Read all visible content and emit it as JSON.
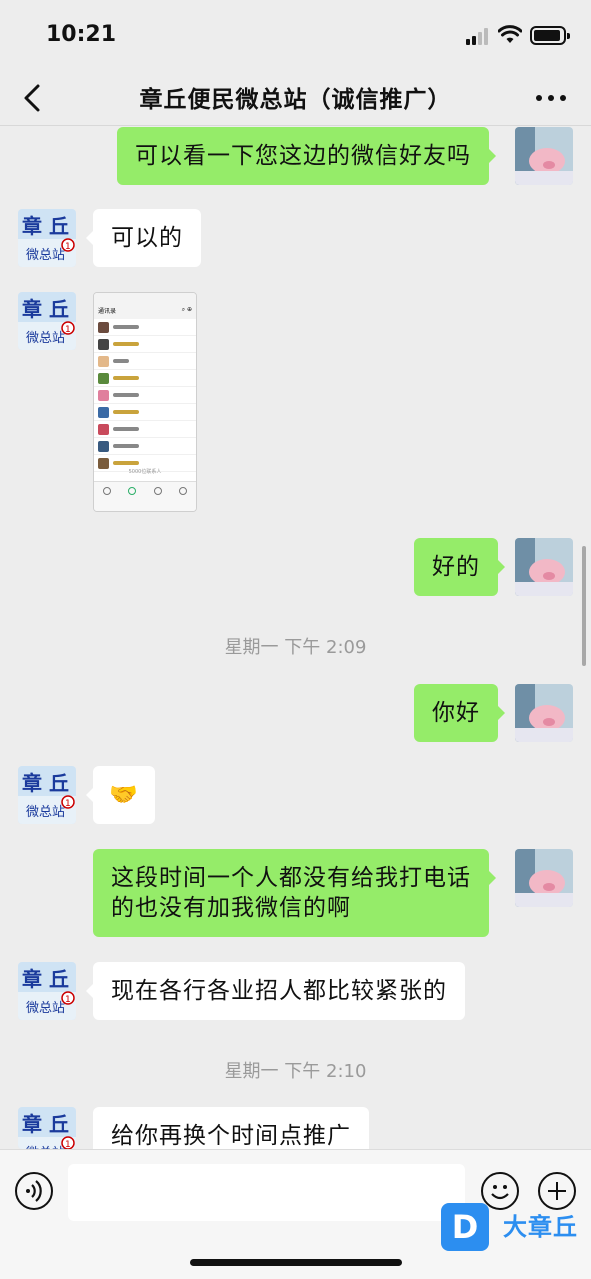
{
  "status_bar": {
    "time": "10:21"
  },
  "nav": {
    "title": "章丘便民微总站（诚信推广）"
  },
  "messages": [
    {
      "side": "out",
      "text": "可以看一下您这边的微信好友吗"
    },
    {
      "side": "in",
      "text": "可以的"
    },
    {
      "side": "in",
      "type": "image",
      "text": ""
    },
    {
      "side": "out",
      "text": "好的"
    },
    {
      "side": "out",
      "text": "你好"
    },
    {
      "side": "in",
      "text": "🤝"
    },
    {
      "side": "out",
      "line1": "这段时间一个人都没有给我打电话",
      "line2": "的也没有加我微信的啊"
    },
    {
      "side": "in",
      "text": "现在各行各业招人都比较紧张的"
    },
    {
      "side": "in",
      "text": "给你再换个时间点推广"
    }
  ],
  "timestamps": [
    "星期一 下午 2:09",
    "星期一 下午 2:10"
  ],
  "contact_avatar_text": {
    "line1": "章 丘",
    "line2": "微总站",
    "badge": "1"
  },
  "screenshot_preview": {
    "header": "通讯录",
    "footer": "5000位联系人"
  },
  "input_bar": {
    "placeholder": ""
  },
  "watermark": {
    "text": "大章丘",
    "logo": "D"
  },
  "colors": {
    "outgoing_bubble": "#95ec69",
    "incoming_bubble": "#ffffff",
    "background": "#ededed",
    "brand_blue": "#2c8ef0"
  },
  "icons": [
    "back-chevron-icon",
    "more-dots-icon",
    "voice-icon",
    "emoji-icon",
    "plus-icon",
    "signal-icon",
    "wifi-icon",
    "battery-icon",
    "handshake-emoji"
  ]
}
